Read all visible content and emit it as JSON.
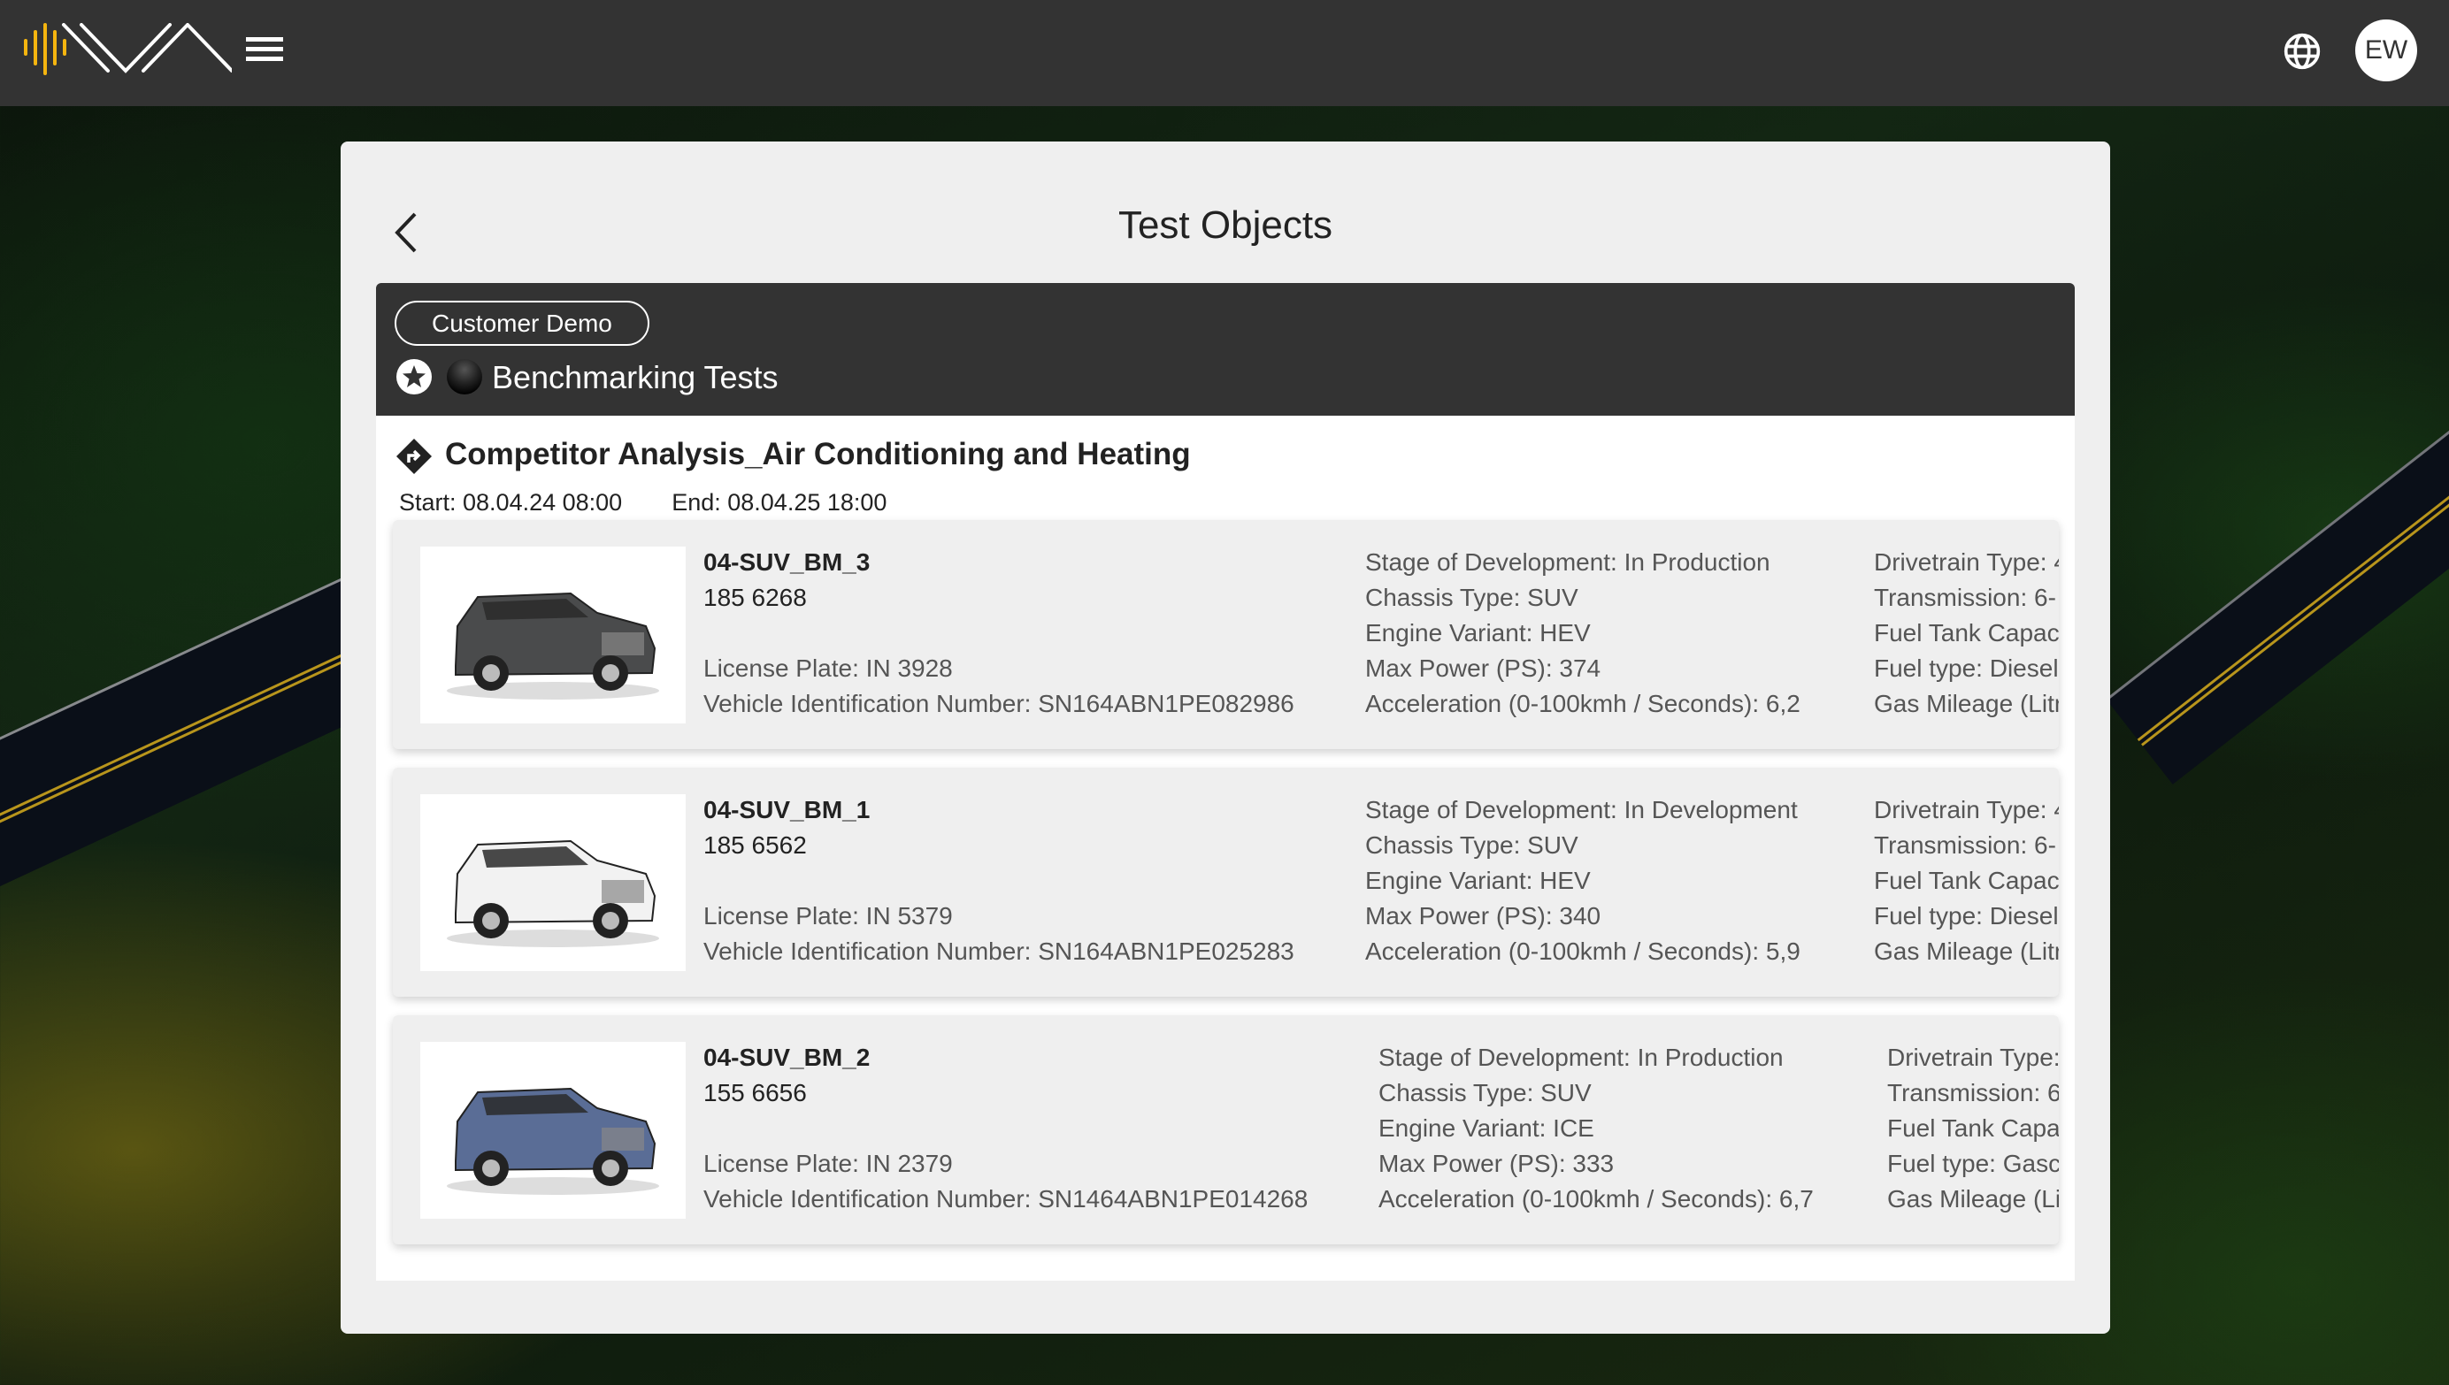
{
  "topbar": {
    "logo_name": "WA logo",
    "menu_icon": "hamburger-menu-icon",
    "language_icon": "globe-icon",
    "avatar_initials": "EW"
  },
  "panel": {
    "title": "Test Objects",
    "back_icon": "chevron-left-icon"
  },
  "group": {
    "tag": "Customer Demo",
    "title": "Benchmarking Tests",
    "icons": [
      "star-circle-icon",
      "status-ball-icon"
    ]
  },
  "project": {
    "icon": "directions-diamond-icon",
    "title": "Competitor Analysis_Air Conditioning and Heating",
    "start": "Start: 08.04.24 08:00",
    "end": "End: 08.04.25 18:00"
  },
  "vehicles": [
    {
      "name": "04-SUV_BM_3",
      "number": "185 6268",
      "license_plate": "License Plate: IN 3928",
      "vin": "Vehicle Identification Number: SN164ABN1PE082986",
      "car_color": "#4a4b4c",
      "specs": [
        "Stage of Development: In Production",
        "Chassis Type: SUV",
        "Engine Variant: HEV",
        "Max Power (PS): 374",
        "Acceleration (0-100kmh / Seconds): 6,2"
      ],
      "specs2": [
        "Drivetrain Type: 4",
        "Transmission: 6-",
        "Fuel Tank Capac",
        "Fuel type: Diesel",
        "Gas Mileage (Litr"
      ]
    },
    {
      "name": "04-SUV_BM_1",
      "number": "185 6562",
      "license_plate": "License Plate: IN 5379",
      "vin": "Vehicle Identification Number: SN164ABN1PE025283",
      "car_color": "#f2f2f2",
      "specs": [
        "Stage of Development: In Development",
        "Chassis Type: SUV",
        "Engine Variant: HEV",
        "Max Power (PS): 340",
        "Acceleration (0-100kmh / Seconds): 5,9"
      ],
      "specs2": [
        "Drivetrain Type: 4",
        "Transmission: 6-",
        "Fuel Tank Capac",
        "Fuel type: Diesel",
        "Gas Mileage (Litr"
      ]
    },
    {
      "name": "04-SUV_BM_2",
      "number": "155 6656",
      "license_plate": "License Plate: IN 2379",
      "vin": "Vehicle Identification Number: SN1464ABN1PE014268",
      "car_color": "#5a6d96",
      "specs": [
        "Stage of Development: In Production",
        "Chassis Type: SUV",
        "Engine Variant: ICE",
        "Max Power (PS): 333",
        "Acceleration (0-100kmh / Seconds): 6,7"
      ],
      "specs2": [
        "Drivetrain Type:",
        "Transmission: 6",
        "Fuel Tank Capa",
        "Fuel type: Gasc",
        "Gas Mileage (Li"
      ]
    }
  ],
  "colors": {
    "topbar": "#333333",
    "panel": "#efefef",
    "group_header": "#333333",
    "logo_accent": "#f5b50f"
  }
}
